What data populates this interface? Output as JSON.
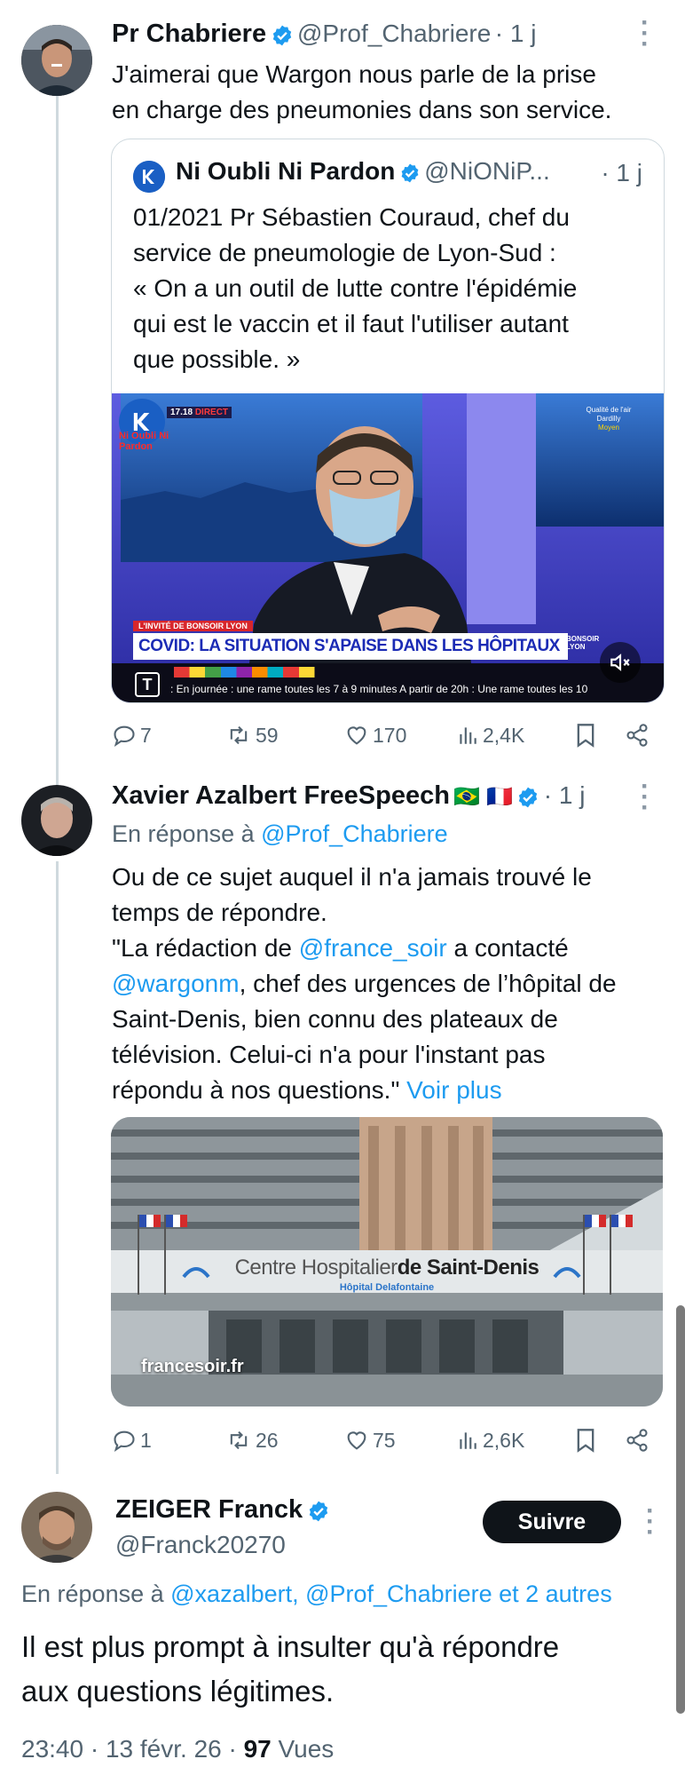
{
  "tweet1": {
    "name": "Pr Chabriere",
    "handle": "@Prof_Chabriere",
    "time": "· 1 j",
    "text_line1": "J'aimerai que Wargon nous parle de la prise",
    "text_line2": "en charge des pneumonies dans son service.",
    "quote": {
      "name": "Ni Oubli Ni Pardon",
      "handle": "@NiONiP...",
      "time": "· 1 j",
      "line1": "01/2021 Pr Sébastien Couraud, chef du",
      "line2": "service de pneumologie de Lyon-Sud :",
      "line3": "« On a un outil de lutte contre l'épidémie",
      "line4": "qui est le vaccin et il faut l'utiliser autant",
      "line5": "que possible. »",
      "video": {
        "time_badge": "17.18",
        "live_badge": "DIRECT",
        "logo_text": "Ni Oubli Ni Pardon",
        "guest_label": "L'INVITÉ DE BONSOIR LYON",
        "headline": "COVID: LA SITUATION S'APAISE DANS LES HÔPITAUX",
        "show_tag": "BONSOIR LYON",
        "ticker": ": En journée : une rame toutes les 7 à 9 minutes A partir de 20h : Une rame toutes les 10",
        "air_quality": "Qualité de l'air",
        "air_city": "Dardilly",
        "air_level": "Moyen"
      }
    },
    "replies": "7",
    "reposts": "59",
    "likes": "170",
    "views": "2,4K"
  },
  "tweet2": {
    "name": "Xavier Azalbert FreeSpeech",
    "flags": "🇧🇷 🇫🇷",
    "time": "· 1 j",
    "reply_prefix": "En réponse à",
    "reply_to": "@Prof_Chabriere",
    "line1": "Ou de ce sujet auquel il n'a jamais trouvé le",
    "line2": "temps de répondre.",
    "line3_a": "\"La rédaction de ",
    "line3_link": "@france_soir",
    "line3_b": " a contacté",
    "line4_link": "@wargonm",
    "line4_b": ", chef des urgences de l’hôpital de",
    "line5": "Saint-Denis, bien connu des plateaux de",
    "line6": "télévision. Celui-ci n'a pour l'instant pas",
    "line7_a": "répondu à nos questions.\" ",
    "see_more": "Voir plus",
    "card": {
      "sign_a": "Centre Hospitalier",
      "sign_b": "de Saint-Denis",
      "sign_sub": "Hôpital Delafontaine",
      "domain": "francesoir.fr"
    },
    "replies": "1",
    "reposts": "26",
    "likes": "75",
    "views": "2,6K"
  },
  "tweet3": {
    "name": "ZEIGER Franck",
    "handle": "@Franck20270",
    "follow": "Suivre",
    "reply_prefix": "En réponse à",
    "reply_to": "@xazalbert, @Prof_Chabriere et 2 autres",
    "line1": "Il est plus prompt à insulter qu'à répondre",
    "line2": "aux questions légitimes.",
    "timestamp": "23:40 · 13 févr. 26 · ",
    "views_count": "97",
    "views_label": " Vues"
  },
  "colors": {
    "accent": "#1d9bf0",
    "text": "#0f1419",
    "secondary": "#536471"
  }
}
